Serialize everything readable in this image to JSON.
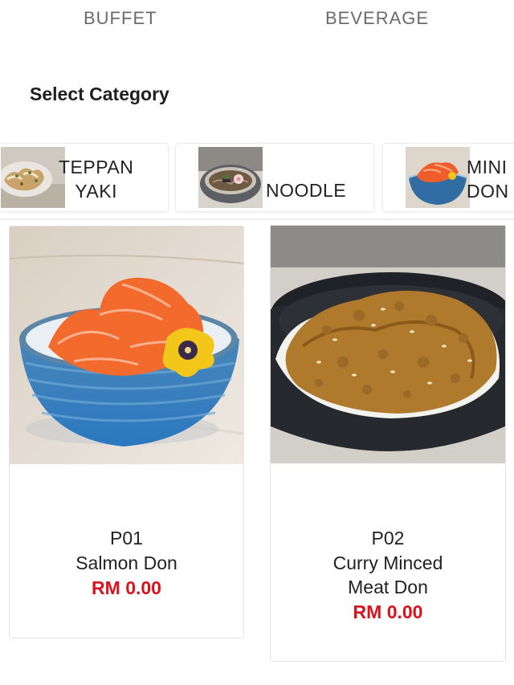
{
  "tabs": {
    "buffet": "BUFFET",
    "beverage": "BEVERAGE"
  },
  "section_title": "Select Category",
  "categories": [
    {
      "line1": "TEPPAN",
      "line2": "YAKI"
    },
    {
      "line1": "NOODLE"
    },
    {
      "line1": "MINI",
      "line2": "DON"
    }
  ],
  "products": [
    {
      "code": "P01",
      "name": "Salmon Don",
      "price": "RM 0.00"
    },
    {
      "code": "P02",
      "name_line1": "Curry Minced",
      "name_line2": "Meat Don",
      "price": "RM 0.00"
    }
  ],
  "colors": {
    "price": "#d9121b",
    "tab_text": "#6b6b6b"
  }
}
